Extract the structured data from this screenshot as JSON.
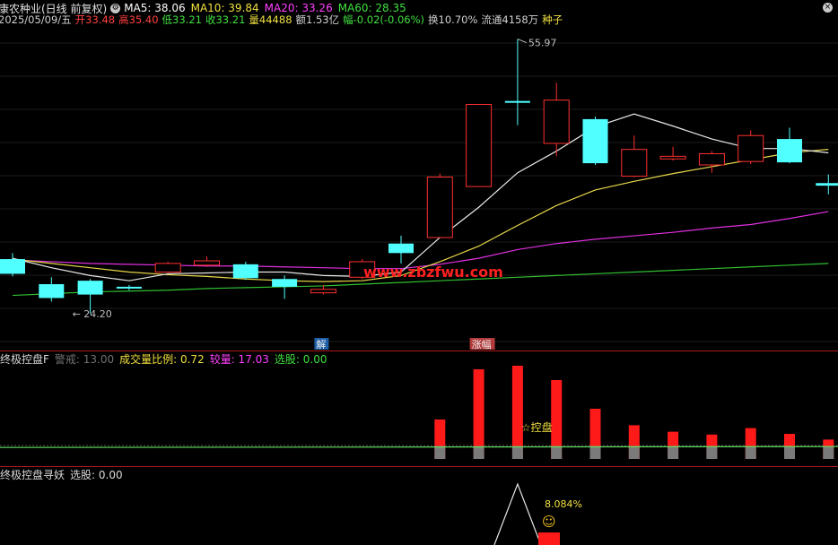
{
  "header": {
    "stock_title": "康农种业(日线 前复权)",
    "ma_labels": [
      {
        "text": "MA5: 38.06",
        "color": "#ffffff"
      },
      {
        "text": "MA10: 39.84",
        "color": "#f0e040"
      },
      {
        "text": "MA20: 33.26",
        "color": "#ff40ff"
      },
      {
        "text": "MA60: 28.35",
        "color": "#40e040"
      }
    ],
    "quote": [
      {
        "text": "2025/05/09/五",
        "color": "#d0d0d0"
      },
      {
        "text": "开33.48",
        "color": "#ff4040"
      },
      {
        "text": "高35.40",
        "color": "#ff4040"
      },
      {
        "text": "低33.21",
        "color": "#40e040"
      },
      {
        "text": "收33.21",
        "color": "#40e040"
      },
      {
        "text": "量44488",
        "color": "#f0e040"
      },
      {
        "text": "额1.53亿",
        "color": "#d0d0d0"
      },
      {
        "text": "幅-0.02(-0.06%)",
        "color": "#40e040"
      },
      {
        "text": "换10.70%",
        "color": "#d0d0d0"
      },
      {
        "text": "流通4158万",
        "color": "#d0d0d0"
      },
      {
        "text": "种子",
        "color": "#f0e040"
      }
    ]
  },
  "chart_data": {
    "type": "candlestick",
    "ylim": [
      22,
      58
    ],
    "candles": [
      {
        "o": 30.5,
        "c": 28.8,
        "h": 31.2,
        "l": 28.5
      },
      {
        "o": 27.6,
        "c": 26.0,
        "h": 28.4,
        "l": 25.6
      },
      {
        "o": 28.0,
        "c": 26.4,
        "h": 28.2,
        "l": 24.2
      },
      {
        "o": 27.3,
        "c": 27.2,
        "h": 27.5,
        "l": 26.9
      },
      {
        "o": 29.0,
        "c": 30.0,
        "h": 30.2,
        "l": 28.9
      },
      {
        "o": 29.8,
        "c": 30.3,
        "h": 30.8,
        "l": 29.6
      },
      {
        "o": 29.9,
        "c": 28.3,
        "h": 30.2,
        "l": 28.1
      },
      {
        "o": 28.2,
        "c": 27.3,
        "h": 28.6,
        "l": 25.9
      },
      {
        "o": 26.6,
        "c": 27.0,
        "h": 27.5,
        "l": 26.4
      },
      {
        "o": 28.4,
        "c": 30.2,
        "h": 30.5,
        "l": 28.2
      },
      {
        "o": 32.3,
        "c": 31.2,
        "h": 33.2,
        "l": 30.0
      },
      {
        "o": 33.0,
        "c": 40.0,
        "h": 40.4,
        "l": 33.0
      },
      {
        "o": 38.9,
        "c": 48.4,
        "h": 48.4,
        "l": 38.9
      },
      {
        "o": 48.8,
        "c": 48.6,
        "h": 55.97,
        "l": 46.0
      },
      {
        "o": 43.9,
        "c": 48.9,
        "h": 50.9,
        "l": 42.4
      },
      {
        "o": 46.7,
        "c": 41.6,
        "h": 47.0,
        "l": 41.4
      },
      {
        "o": 40.1,
        "c": 43.2,
        "h": 44.8,
        "l": 40.0
      },
      {
        "o": 42.1,
        "c": 42.4,
        "h": 43.5,
        "l": 41.9
      },
      {
        "o": 41.4,
        "c": 42.7,
        "h": 43.0,
        "l": 40.5
      },
      {
        "o": 41.8,
        "c": 44.8,
        "h": 45.4,
        "l": 41.5
      },
      {
        "o": 44.4,
        "c": 41.7,
        "h": 45.7,
        "l": 41.6
      },
      {
        "o": 39.3,
        "c": 39.0,
        "h": 40.3,
        "l": 38.0
      }
    ],
    "ma5": [
      30.6,
      29.5,
      28.6,
      28.0,
      28.8,
      28.9,
      29.0,
      29.0,
      28.6,
      28.5,
      29.0,
      33.0,
      36.5,
      40.5,
      43.0,
      45.8,
      47.3,
      45.9,
      44.4,
      43.3,
      43.3,
      42.8
    ],
    "ma10": [
      30.5,
      30.0,
      29.5,
      29.0,
      28.7,
      28.5,
      28.2,
      28.0,
      27.9,
      28.0,
      28.6,
      30.2,
      32.0,
      34.4,
      36.7,
      38.5,
      39.5,
      40.4,
      41.2,
      42.0,
      42.8,
      43.2
    ],
    "ma20": [
      30.4,
      30.2,
      30.0,
      29.9,
      29.8,
      29.7,
      29.7,
      29.6,
      29.5,
      29.4,
      29.4,
      29.9,
      30.6,
      31.6,
      32.3,
      32.8,
      33.2,
      33.6,
      34.1,
      34.5,
      35.2,
      36.0
    ],
    "ma60": [
      26.3,
      26.5,
      26.7,
      26.8,
      26.9,
      27.1,
      27.2,
      27.3,
      27.4,
      27.6,
      27.8,
      28.0,
      28.2,
      28.4,
      28.6,
      28.8,
      29.0,
      29.2,
      29.4,
      29.6,
      29.8,
      30.0
    ],
    "high_label": "55.97",
    "low_label": "24.20",
    "tags": [
      {
        "text": "解",
        "index": 8,
        "bg": "#1e5fa8"
      },
      {
        "text": "涨幅",
        "index": 12,
        "bg": "#b23a3a"
      }
    ],
    "watermark": "www.zbzfwu.com",
    "panel2": {
      "labels": [
        {
          "text": "终极控盘F",
          "color": "#d8d8d8"
        },
        {
          "text": "警戒: 13.00",
          "color": "#707070"
        },
        {
          "text": "成交量比例: 0.72",
          "color": "#f0e040"
        },
        {
          "text": "较量: 17.03",
          "color": "#ff40ff"
        },
        {
          "text": "选股: 0.00",
          "color": "#40e040"
        }
      ],
      "ylim": [
        0,
        13
      ],
      "red_bars": [
        0,
        0,
        0,
        0,
        0,
        0,
        0,
        0,
        0,
        0,
        0,
        5.5,
        12.5,
        13.0,
        11.0,
        7.0,
        4.7,
        3.8,
        3.4,
        4.3,
        3.5,
        2.7
      ],
      "grey_bars": [
        0,
        0,
        0,
        0,
        0,
        0,
        0,
        0,
        0,
        0,
        0,
        1.8,
        1.8,
        1.8,
        1.8,
        1.8,
        1.8,
        1.8,
        1.8,
        1.8,
        1.8,
        1.8
      ],
      "line": 1.6,
      "annotation": {
        "text": "☆控盘",
        "index": 13
      }
    },
    "panel3": {
      "labels": [
        {
          "text": "终极控盘寻妖",
          "color": "#d8d8d8"
        },
        {
          "text": "选股: 0.00",
          "color": "#d8d8d8"
        }
      ],
      "percent_label": "8.084%",
      "emoji": "☺",
      "peak_index": 13
    }
  }
}
